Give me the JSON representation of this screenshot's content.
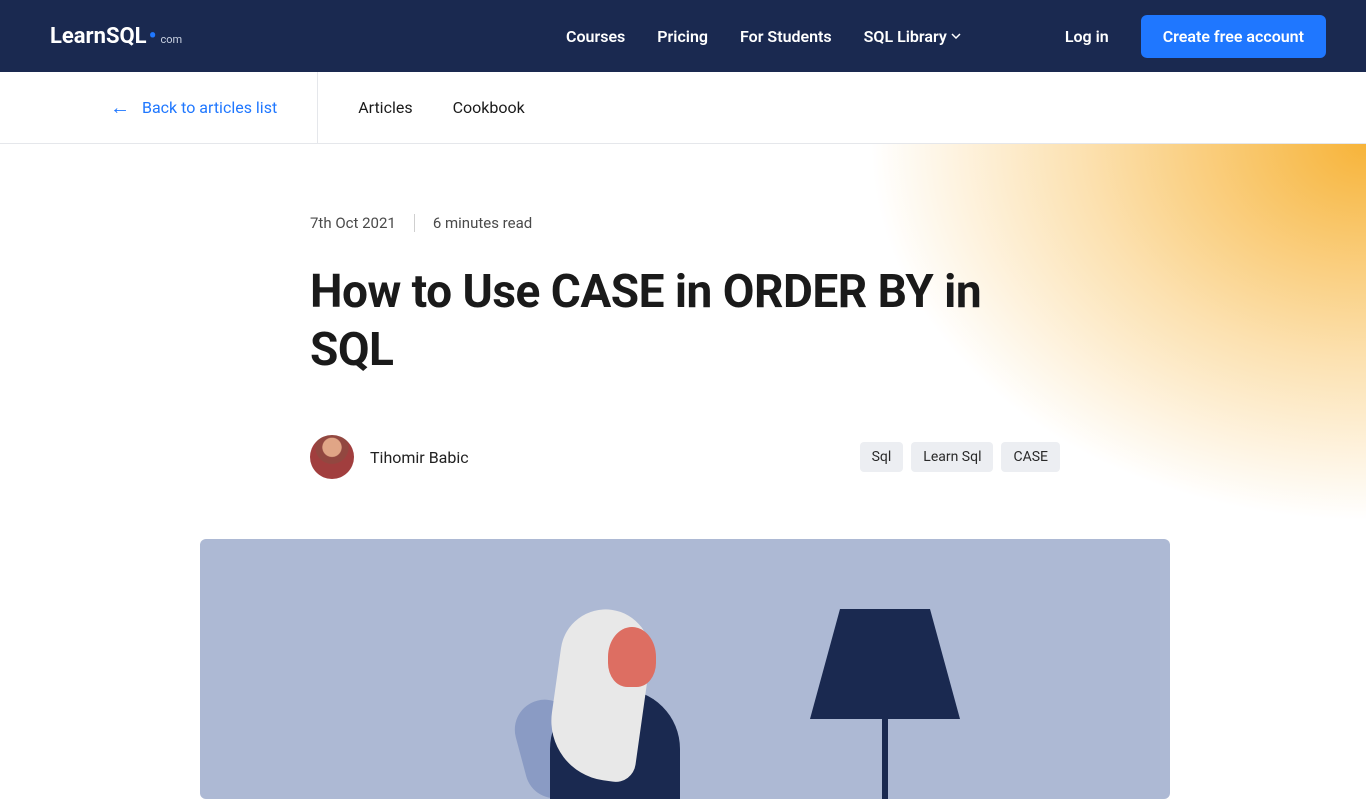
{
  "nav": {
    "logo_main": "LearnSQL",
    "logo_sub": "com",
    "items": [
      "Courses",
      "Pricing",
      "For Students",
      "SQL Library"
    ],
    "login": "Log in",
    "cta": "Create free account"
  },
  "subnav": {
    "back": "Back to articles list",
    "links": [
      "Articles",
      "Cookbook"
    ]
  },
  "article": {
    "date": "7th Oct 2021",
    "read_time": "6 minutes read",
    "title": "How to Use CASE in ORDER BY in SQL",
    "author": "Tihomir Babic",
    "tags": [
      "Sql",
      "Learn Sql",
      "CASE"
    ]
  }
}
